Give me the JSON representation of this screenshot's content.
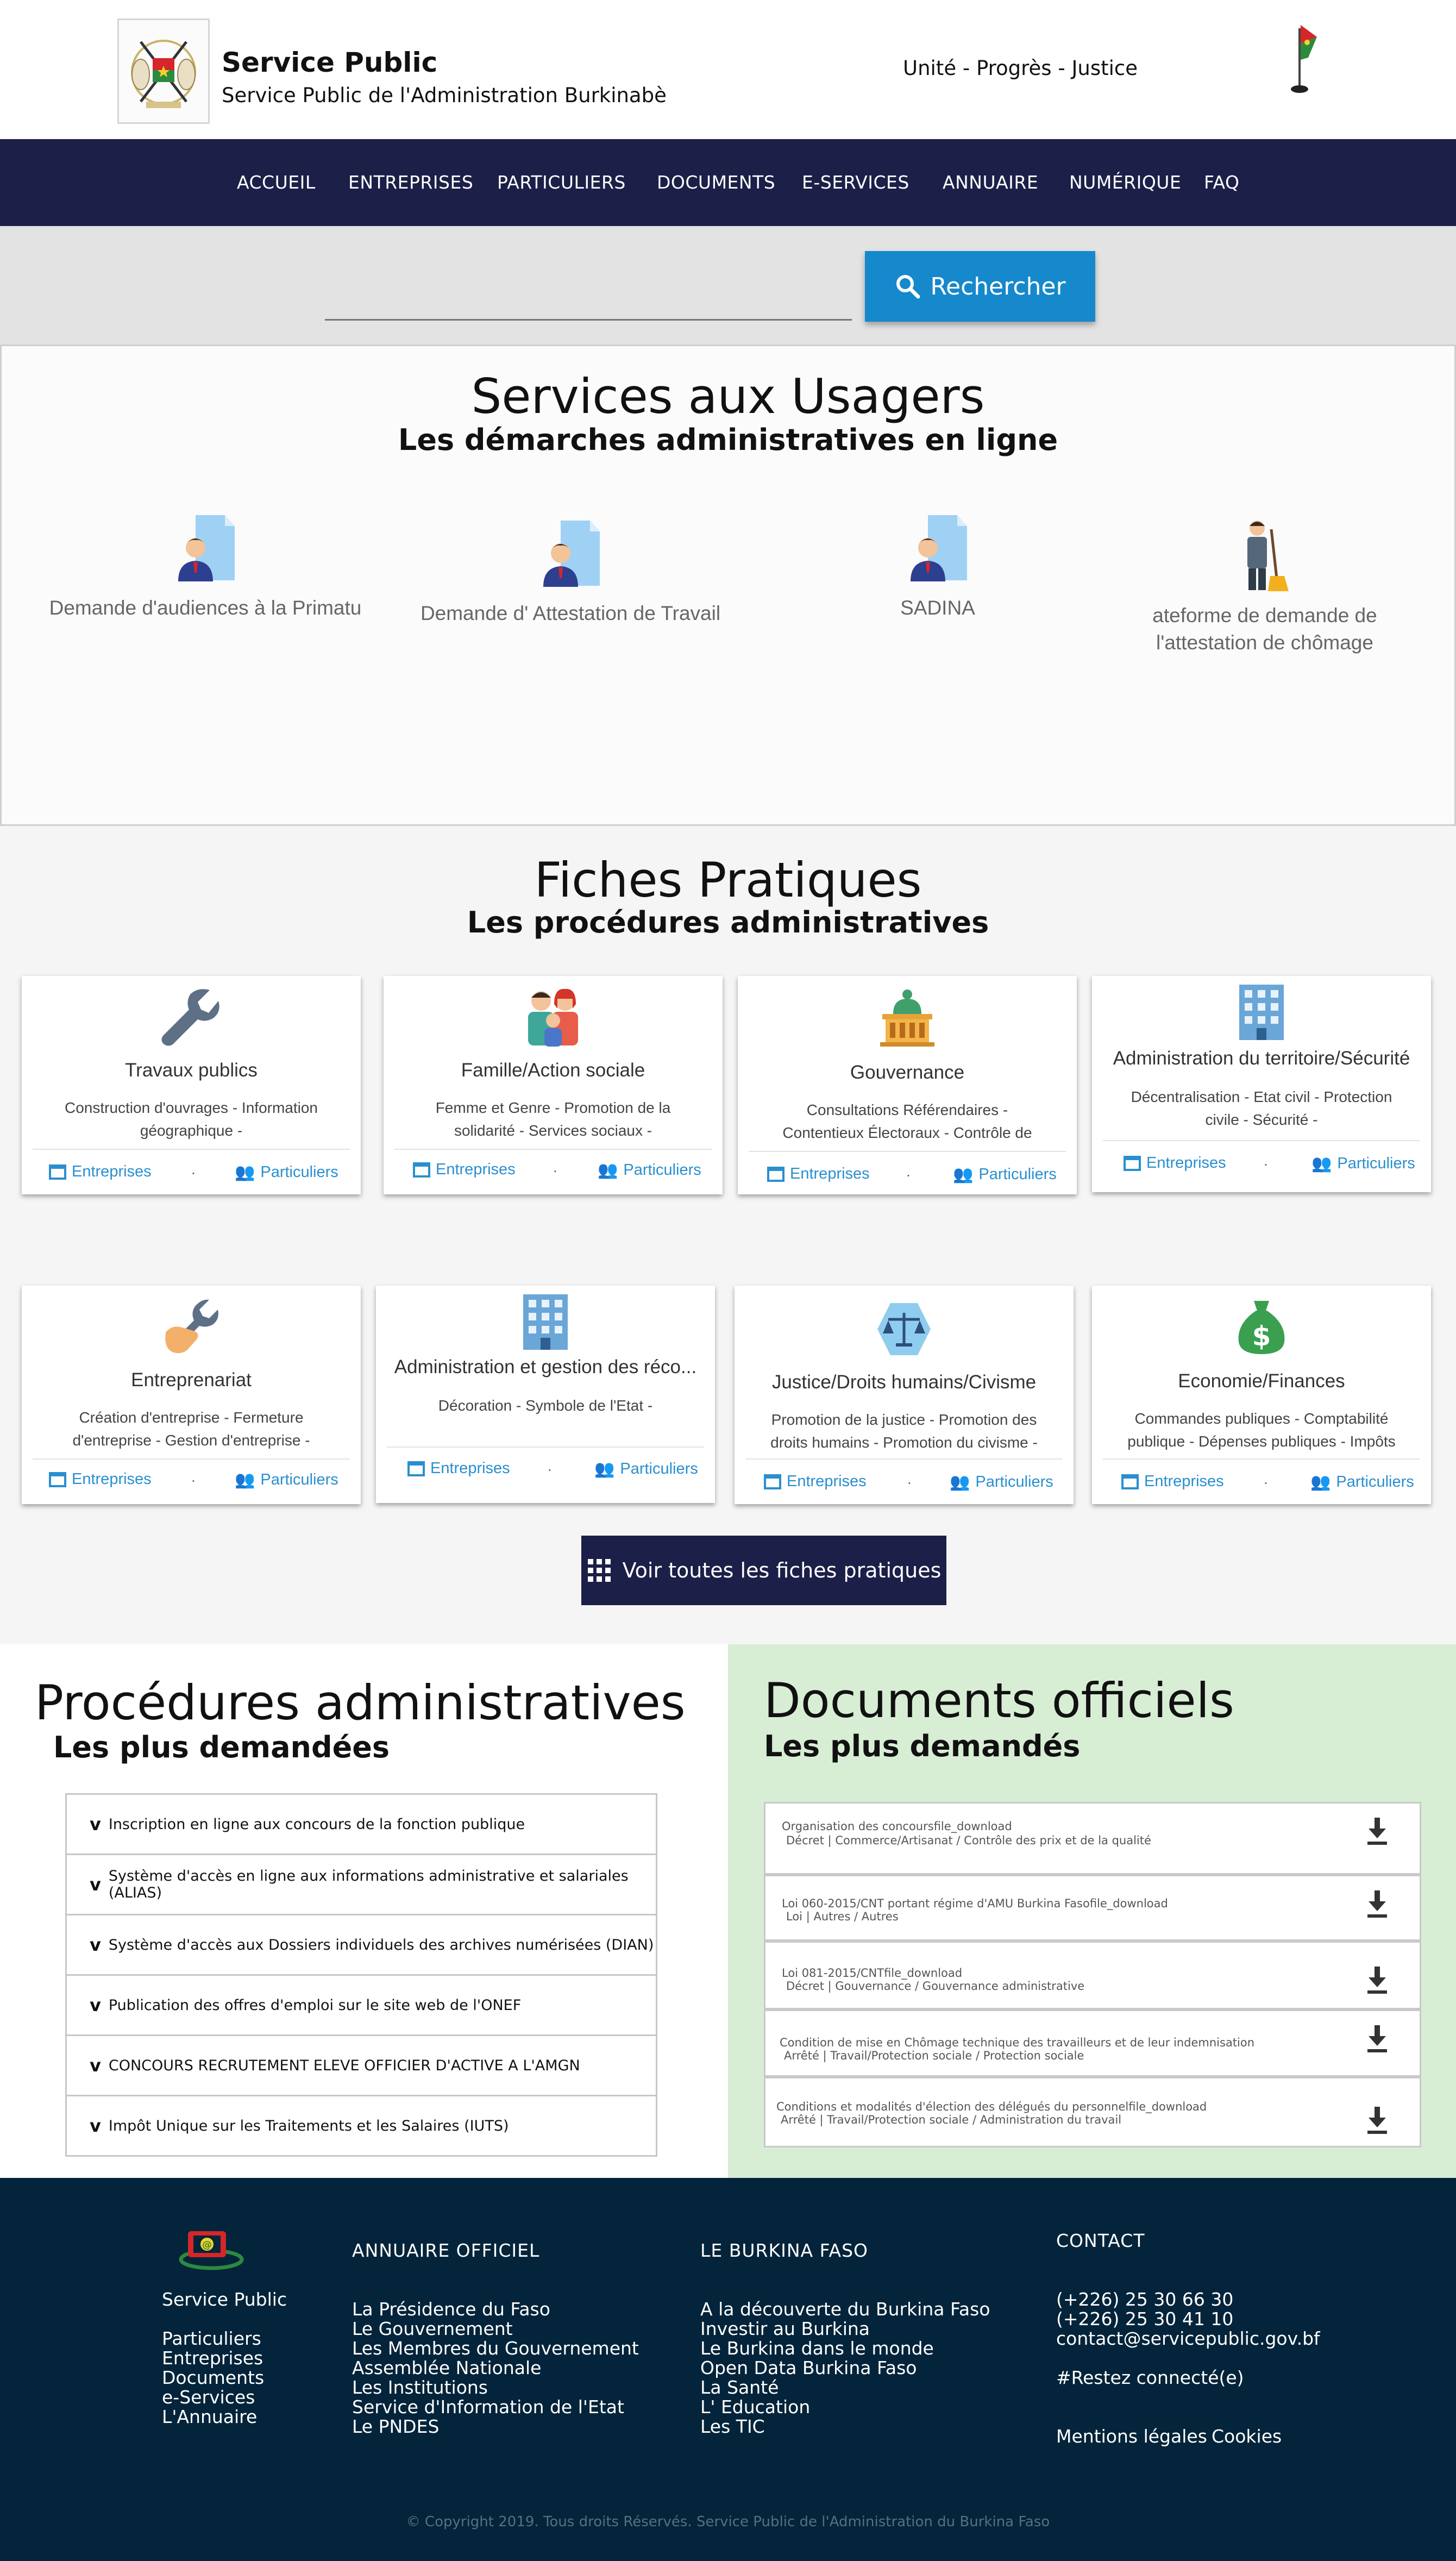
{
  "header": {
    "title": "Service Public",
    "subtitle": "Service Public de l'Administration Burkinabè",
    "motto": "Unité - Progrès - Justice"
  },
  "nav": [
    "ACCUEIL",
    "ENTREPRISES",
    "PARTICULIERS",
    "DOCUMENTS",
    "E-SERVICES",
    "ANNUAIRE",
    "NUMÉRIQUE",
    "FAQ"
  ],
  "search": {
    "value": "",
    "placeholder": "",
    "button_label": "Rechercher"
  },
  "services": {
    "title": "Services aux Usagers",
    "subtitle": "Les démarches administratives en ligne",
    "items": [
      {
        "label": "Demande d'audiences à la Primatu",
        "icon": "document-person-icon"
      },
      {
        "label": "Demande d' Attestation de Travail",
        "icon": "document-person-icon"
      },
      {
        "label": "SADINA",
        "icon": "document-person-icon"
      },
      {
        "label": "ateforme de demande de l'attestation de chômage",
        "icon": "worker-broom-icon"
      }
    ]
  },
  "fiches": {
    "title": "Fiches Pratiques",
    "subtitle": "Les procédures administratives",
    "link_entreprises": "Entreprises",
    "link_particuliers": "Particuliers",
    "separator": ".",
    "cards": [
      {
        "title": "Travaux publics",
        "desc": "Construction d'ouvrages - Information géographique -",
        "icon": "wrench-icon"
      },
      {
        "title": "Famille/Action sociale",
        "desc": "Femme et Genre - Promotion de la solidarité - Services sociaux -",
        "icon": "family-icon"
      },
      {
        "title": "Gouvernance",
        "desc": "Consultations Référendaires - Contentieux Électoraux - Contrôle de constitutionnalité -",
        "icon": "government-building-icon"
      },
      {
        "title": "Administration du territoire/Sécurité",
        "desc": "Décentralisation - Etat civil - Protection civile - Sécurité -",
        "icon": "office-building-icon"
      },
      {
        "title": "Entreprenariat",
        "desc": "Création d'entreprise - Fermeture d'entreprise - Gestion d'entreprise -",
        "icon": "hand-wrench-icon"
      },
      {
        "title": "Administration et gestion des réco...",
        "desc": "Décoration - Symbole de l'Etat -",
        "icon": "office-building-icon"
      },
      {
        "title": "Justice/Droits humains/Civisme",
        "desc": "Promotion de la justice - Promotion des droits humains - Promotion du civisme -",
        "icon": "scales-icon"
      },
      {
        "title": "Economie/Finances",
        "desc": "Commandes publiques - Comptabilité publique - Dépenses publiques - Impôts et",
        "icon": "money-bag-icon"
      }
    ],
    "all_button": "Voir toutes les fiches pratiques"
  },
  "procedures": {
    "title": "Procédures administratives",
    "subtitle": "Les plus demandées",
    "chevron": "v",
    "items": [
      "Inscription en ligne aux concours de la fonction publique",
      "Système d'accès en ligne aux informations administrative et salariales (ALIAS)",
      "Système d'accès aux Dossiers individuels des archives numérisées (DIAN)",
      "Publication des offres d'emploi sur le site web de l'ONEF",
      "CONCOURS RECRUTEMENT ELEVE OFFICIER D'ACTIVE A L'AMGN",
      "Impôt Unique sur les Traitements et les Salaires (IUTS)"
    ]
  },
  "documents": {
    "title": "Documents officiels",
    "subtitle": "Les plus demandés",
    "items": [
      {
        "title": "Organisation des concoursfile_download",
        "meta": "Décret | Commerce/Artisanat / Contrôle des prix et de la qualité"
      },
      {
        "title": "Loi 060-2015/CNT portant régime d'AMU Burkina Fasofile_download",
        "meta": "Loi | Autres / Autres"
      },
      {
        "title": "Loi 081-2015/CNTfile_download",
        "meta": "Décret | Gouvernance / Gouvernance administrative"
      },
      {
        "title": "Condition de mise en Chômage technique des travailleurs et de leur indemnisation",
        "meta": "Arrêté | Travail/Protection sociale / Protection sociale"
      },
      {
        "title": "Conditions et modalités d'élection des délégués du personnelfile_download",
        "meta": "Arrêté | Travail/Protection sociale / Administration du travail"
      }
    ]
  },
  "footer": {
    "brand": "Service Public",
    "brand_links": [
      "Particuliers",
      "Entreprises",
      "Documents",
      "e-Services",
      "L'Annuaire"
    ],
    "annuaire_title": "ANNUAIRE OFFICIEL",
    "annuaire_links": [
      "La Présidence du Faso",
      "Le Gouvernement",
      "Les Membres du Gouvernement",
      "Assemblée Nationale",
      "Les Institutions",
      "Service d'Information de l'Etat",
      "Le PNDES"
    ],
    "burkina_title": "LE BURKINA FASO",
    "burkina_links": [
      "A la découverte du Burkina Faso",
      "Investir au Burkina",
      "Le Burkina dans le monde",
      "Open Data Burkina Faso",
      "La Santé",
      "L' Education",
      "Les TIC"
    ],
    "contact_title": "CONTACT",
    "phone1": "(+226) 25 30 66 30",
    "phone2": "(+226) 25 30 41 10",
    "email": "contact@servicepublic.gov.bf",
    "hashtag": "#Restez connecté(e)",
    "legal": "Mentions légales",
    "cookies": "Cookies",
    "copyright": "© Copyright 2019. Tous droits Réservés. Service Public de l'Administration du Burkina Faso"
  },
  "colors": {
    "nav": "#1c1f47",
    "accent": "#1688cc",
    "footer": "#03243a",
    "docs_bg": "#d7eed5",
    "link": "#2a8fcf"
  }
}
